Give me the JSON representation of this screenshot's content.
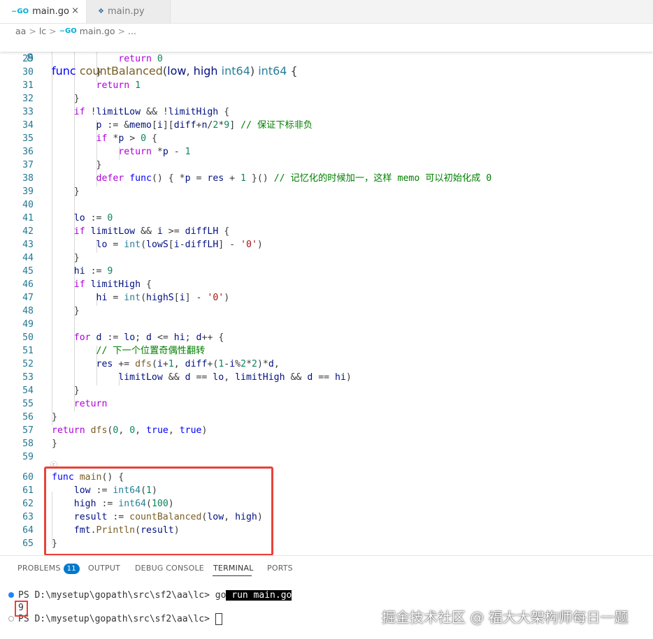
{
  "tabs": [
    {
      "label": "main.go",
      "icon": "go-icon",
      "active": true
    },
    {
      "label": "main.py",
      "icon": "python-icon",
      "active": false
    }
  ],
  "tab_close_glyph": "×",
  "breadcrumb": [
    "aa",
    "lc",
    "main.go",
    "..."
  ],
  "breadcrumb_sep": ">",
  "sticky_line": {
    "num": "8",
    "text": "func countBalanced(low, high int64) int64 {"
  },
  "code_lines": [
    {
      "num": "29",
      "text": "            return 0"
    },
    {
      "num": "30",
      "text": "        }"
    },
    {
      "num": "31",
      "text": "        return 1"
    },
    {
      "num": "32",
      "text": "    }"
    },
    {
      "num": "33",
      "text": "    if !limitLow && !limitHigh {"
    },
    {
      "num": "34",
      "text": "        p := &memo[i][diff+n/2*9] // 保证下标非负"
    },
    {
      "num": "35",
      "text": "        if *p > 0 {"
    },
    {
      "num": "36",
      "text": "            return *p - 1"
    },
    {
      "num": "37",
      "text": "        }"
    },
    {
      "num": "38",
      "text": "        defer func() { *p = res + 1 }() // 记忆化的时候加一，这样 memo 可以初始化成 0"
    },
    {
      "num": "39",
      "text": "    }"
    },
    {
      "num": "40",
      "text": ""
    },
    {
      "num": "41",
      "text": "    lo := 0"
    },
    {
      "num": "42",
      "text": "    if limitLow && i >= diffLH {"
    },
    {
      "num": "43",
      "text": "        lo = int(lowS[i-diffLH] - '0')"
    },
    {
      "num": "44",
      "text": "    }"
    },
    {
      "num": "45",
      "text": "    hi := 9"
    },
    {
      "num": "46",
      "text": "    if limitHigh {"
    },
    {
      "num": "47",
      "text": "        hi = int(highS[i] - '0')"
    },
    {
      "num": "48",
      "text": "    }"
    },
    {
      "num": "49",
      "text": ""
    },
    {
      "num": "50",
      "text": "    for d := lo; d <= hi; d++ {"
    },
    {
      "num": "51",
      "text": "        // 下一个位置奇偶性翻转"
    },
    {
      "num": "52",
      "text": "        res += dfs(i+1, diff+(1-i%2*2)*d,"
    },
    {
      "num": "53",
      "text": "            limitLow && d == lo, limitHigh && d == hi)"
    },
    {
      "num": "54",
      "text": "    }"
    },
    {
      "num": "55",
      "text": "    return"
    },
    {
      "num": "56",
      "text": "}"
    },
    {
      "num": "57",
      "text": "return dfs(0, 0, true, true)"
    },
    {
      "num": "58",
      "text": "}"
    },
    {
      "num": "59",
      "text": ""
    },
    {
      "num": "60",
      "text": "func main() {"
    },
    {
      "num": "61",
      "text": "    low := int64(1)"
    },
    {
      "num": "62",
      "text": "    high := int64(100)"
    },
    {
      "num": "63",
      "text": "    result := countBalanced(low, high)"
    },
    {
      "num": "64",
      "text": "    fmt.Println(result)"
    },
    {
      "num": "65",
      "text": "}"
    }
  ],
  "inline_hint": "ⓒ",
  "panel": {
    "tabs": [
      "PROBLEMS",
      "OUTPUT",
      "DEBUG CONSOLE",
      "TERMINAL",
      "PORTS"
    ],
    "problems_count": "11",
    "active_tab": "TERMINAL"
  },
  "terminal": {
    "line1_prompt": "PS D:\\mysetup\\gopath\\src\\sf2\\aa\\lc> ",
    "line1_cmd_plain": "go",
    "line1_cmd_highlight": " run main.go",
    "output": "9",
    "line3_prompt": "PS D:\\mysetup\\gopath\\src\\sf2\\aa\\lc> "
  },
  "watermark": "掘金技术社区 @ 福大大架构师每日一题",
  "colors": {
    "keyword": "#0000ff",
    "number": "#098658",
    "function": "#795e26",
    "type": "#267f99",
    "comment": "#008000",
    "string": "#a31515",
    "highlight_box": "#e8423a"
  }
}
